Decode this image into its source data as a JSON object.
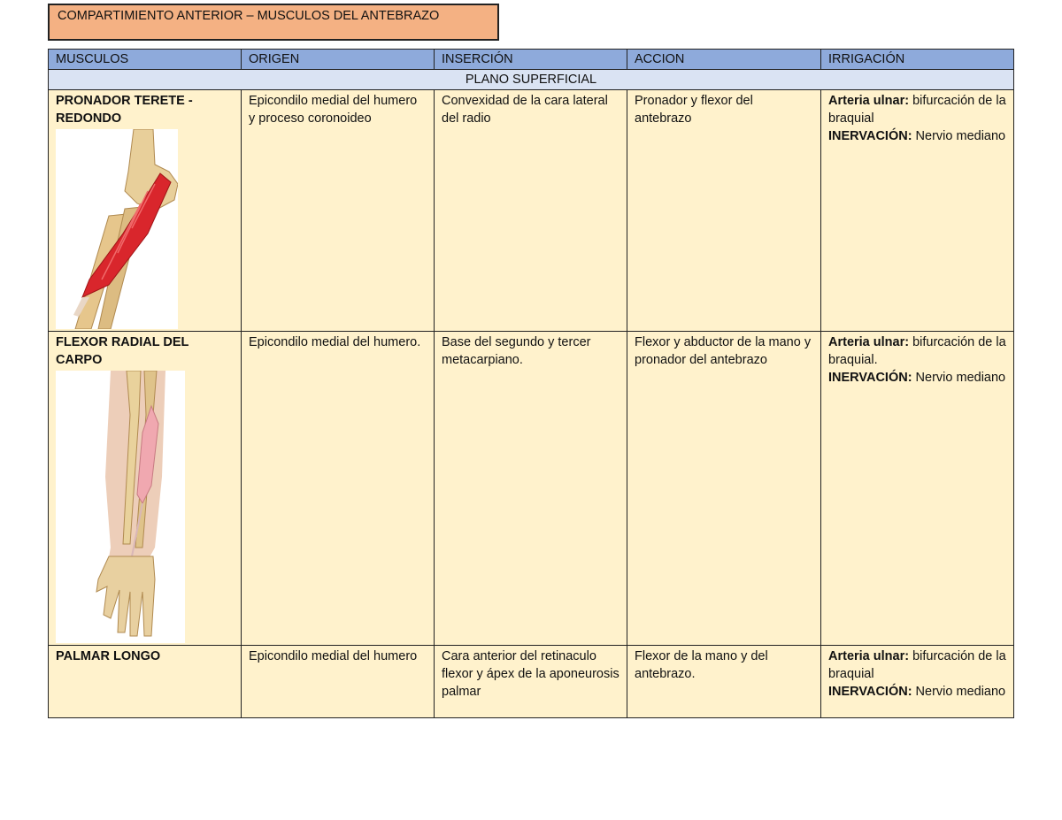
{
  "document": {
    "title": "COMPARTIMIENTO ANTERIOR – MUSCULOS DEL ANTEBRAZO"
  },
  "table": {
    "headers": [
      "MUSCULOS",
      "ORIGEN",
      "INSERCIÓN",
      "ACCION",
      "IRRIGACIÓN"
    ],
    "section_label": "PLANO SUPERFICIAL",
    "rows": [
      {
        "muscle": "PRONADOR TERETE - REDONDO",
        "origin": "Epicondilo medial del humero y proceso coronoideo",
        "insertion": "Convexidad de la cara lateral del radio",
        "action": "Pronador y flexor del antebrazo",
        "artery_label": "Arteria ulnar:",
        "artery_text": " bifurcación de la braquial",
        "nerve_label": "INERVACIÓN:",
        "nerve_text": " Nervio mediano"
      },
      {
        "muscle": "FLEXOR RADIAL DEL CARPO",
        "origin": "Epicondilo medial del humero.",
        "insertion": "Base del segundo y tercer metacarpiano.",
        "action": "Flexor y abductor de la mano y  pronador del antebrazo",
        "artery_label": "Arteria ulnar:",
        "artery_text": " bifurcación de la braquial.",
        "nerve_label": "INERVACIÓN:",
        "nerve_text": " Nervio mediano"
      },
      {
        "muscle": "PALMAR LONGO",
        "origin": "Epicondilo medial del humero",
        "insertion": "Cara anterior del retinaculo flexor y ápex de la aponeurosis palmar",
        "action": "Flexor de la mano y del antebrazo.",
        "artery_label": "Arteria ulnar:",
        "artery_text": " bifurcación de la braquial",
        "nerve_label": "INERVACIÓN:",
        "nerve_text": " Nervio mediano"
      }
    ]
  },
  "colors": {
    "title_bg": "#f4b183",
    "header_bg": "#8eaadb",
    "section_bg": "#dae3f3",
    "row_bg": "#fff2cc",
    "muscle_red": "#d9262c"
  },
  "icons": [
    "pronator-teres-illustration",
    "flexor-carpi-radialis-illustration"
  ]
}
